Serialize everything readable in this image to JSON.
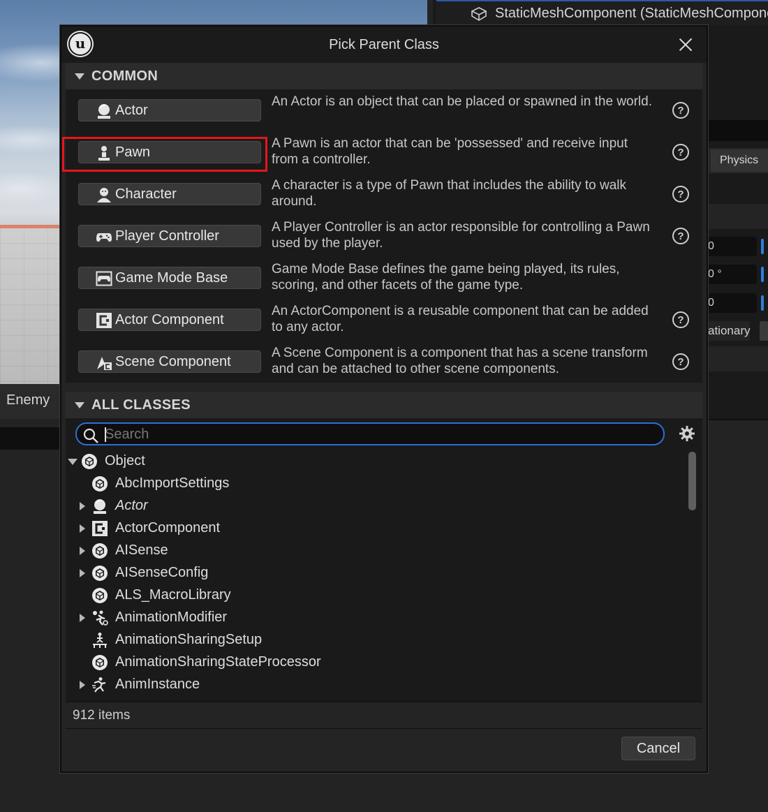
{
  "background": {
    "details_header": "StaticMeshComponent (StaticMeshCompone",
    "physics_tab": "Physics",
    "left_panel_label": "Enemy",
    "field_values": [
      "0",
      "0 °",
      "0"
    ],
    "mobility_fragment": "ationary"
  },
  "dialog": {
    "title": "Pick Parent Class",
    "common_section_label": "COMMON",
    "all_classes_section_label": "ALL CLASSES",
    "common_items": [
      {
        "label": "Actor",
        "icon": "actor-icon",
        "description": "An Actor is an object that can be placed or spawned in the world.",
        "help": "?"
      },
      {
        "label": "Pawn",
        "icon": "pawn-icon",
        "description": "A Pawn is an actor that can be 'possessed' and receive input from a controller.",
        "help": "?"
      },
      {
        "label": "Character",
        "icon": "character-icon",
        "description": "A character is a type of Pawn that includes the ability to walk around.",
        "help": "?"
      },
      {
        "label": "Player Controller",
        "icon": "gamepad-icon",
        "description": "A Player Controller is an actor responsible for controlling a Pawn used by the player.",
        "help": "?"
      },
      {
        "label": "Game Mode Base",
        "icon": "game-mode-icon",
        "description": "Game Mode Base defines the game being played, its rules, scoring, and other facets of the game type.",
        "help": ""
      },
      {
        "label": "Actor Component",
        "icon": "actor-component-icon",
        "description": "An ActorComponent is a reusable component that can be added to any actor.",
        "help": "?"
      },
      {
        "label": "Scene Component",
        "icon": "scene-component-icon",
        "description": "A Scene Component is a component that has a scene transform and can be attached to other scene components.",
        "help": "?"
      }
    ],
    "search": {
      "placeholder": "Search",
      "value": ""
    },
    "tree": [
      {
        "label": "Object",
        "icon": "cube-icon",
        "arrow": "down",
        "depth": 0,
        "italic": false
      },
      {
        "label": "AbcImportSettings",
        "icon": "cube-icon",
        "arrow": "none",
        "depth": 1,
        "italic": false
      },
      {
        "label": "Actor",
        "icon": "actor-icon",
        "arrow": "right",
        "depth": 1,
        "italic": true
      },
      {
        "label": "ActorComponent",
        "icon": "actor-component-icon",
        "arrow": "right",
        "depth": 1,
        "italic": false
      },
      {
        "label": "AISense",
        "icon": "cube-icon",
        "arrow": "right",
        "depth": 1,
        "italic": false
      },
      {
        "label": "AISenseConfig",
        "icon": "cube-icon",
        "arrow": "right",
        "depth": 1,
        "italic": false
      },
      {
        "label": "ALS_MacroLibrary",
        "icon": "cube-icon",
        "arrow": "none",
        "depth": 1,
        "italic": false
      },
      {
        "label": "AnimationModifier",
        "icon": "anim-modifier-icon",
        "arrow": "right",
        "depth": 1,
        "italic": false
      },
      {
        "label": "AnimationSharingSetup",
        "icon": "anim-sharing-icon",
        "arrow": "none",
        "depth": 1,
        "italic": false
      },
      {
        "label": "AnimationSharingStateProcessor",
        "icon": "cube-icon",
        "arrow": "none",
        "depth": 1,
        "italic": false
      },
      {
        "label": "AnimInstance",
        "icon": "anim-instance-icon",
        "arrow": "right",
        "depth": 1,
        "italic": false
      }
    ],
    "item_count": "912 items",
    "cancel_label": "Cancel",
    "highlight_color": "#e4161b",
    "accent_color": "#2b6fd6"
  }
}
